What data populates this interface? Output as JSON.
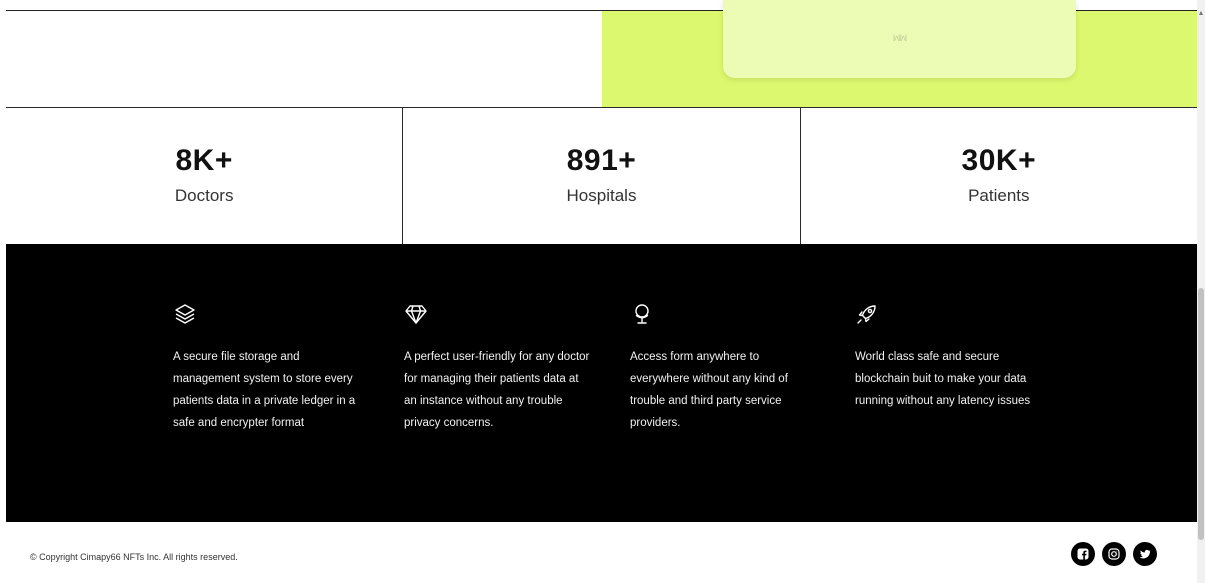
{
  "top": {
    "card_logo": "ꟽꟽ"
  },
  "stats": [
    {
      "value": "8K+",
      "label": "Doctors"
    },
    {
      "value": "891+",
      "label": "Hospitals"
    },
    {
      "value": "30K+",
      "label": "Patients"
    }
  ],
  "features": [
    {
      "icon": "layers-icon",
      "text": "A secure file storage and management system to store every patients data in a private ledger in a safe and encrypter format"
    },
    {
      "icon": "diamond-icon",
      "text": "A perfect user-friendly for any doctor for managing their patients data at an instance without any trouble privacy concerns."
    },
    {
      "icon": "globe-stand-icon",
      "text": "Access form anywhere to everywhere without any kind of trouble and third party service providers."
    },
    {
      "icon": "rocket-icon",
      "text": "World class safe and secure blockchain buit to make your data running without any latency issues"
    }
  ],
  "footer": {
    "copyright": "© Copyright Cimapy66  NFTs Inc. All rights reserved.",
    "socials": [
      "facebook-icon",
      "instagram-icon",
      "twitter-icon"
    ]
  },
  "colors": {
    "accent": "#dcf86e",
    "card": "#ecfcb4",
    "dark": "#000000"
  }
}
